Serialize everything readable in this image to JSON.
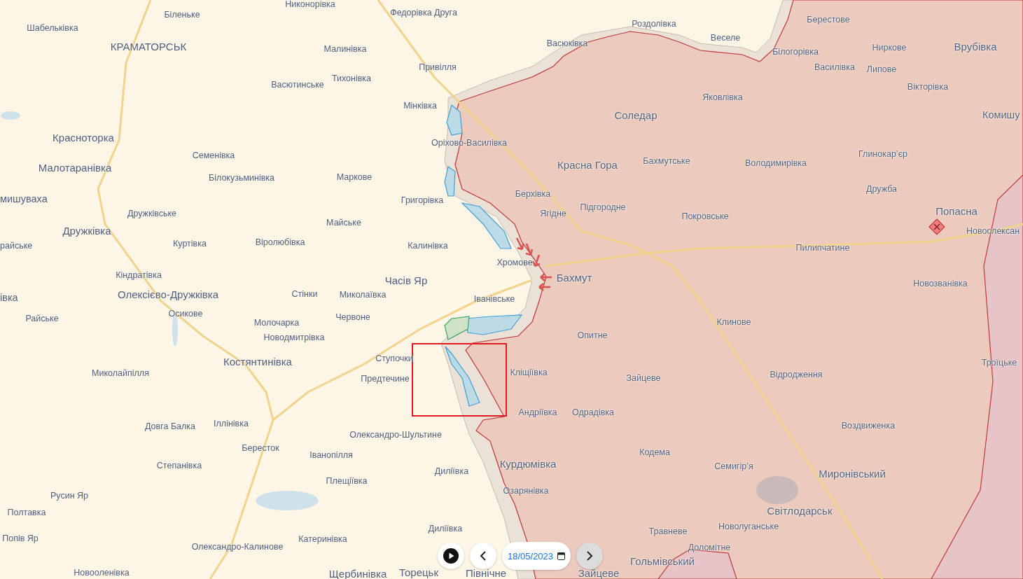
{
  "map": {
    "labels": [
      {
        "text": "Никонорівка",
        "kind": "town"
      },
      {
        "text": "Шабельківка",
        "kind": "town"
      },
      {
        "text": "Біленьке",
        "kind": "town"
      },
      {
        "text": "Федорівка Друга",
        "kind": "town"
      },
      {
        "text": "Роздолівка",
        "kind": "town"
      },
      {
        "text": "Берестове",
        "kind": "town"
      },
      {
        "text": "КРАМАТОРСЬК",
        "kind": "city"
      },
      {
        "text": "Малинівка",
        "kind": "town"
      },
      {
        "text": "Васюківка",
        "kind": "town"
      },
      {
        "text": "Веселе",
        "kind": "town"
      },
      {
        "text": "Білогорівка",
        "kind": "town"
      },
      {
        "text": "Ниркове",
        "kind": "town"
      },
      {
        "text": "Врубівка",
        "kind": "city"
      },
      {
        "text": "Васютинське",
        "kind": "town"
      },
      {
        "text": "Тихонівка",
        "kind": "town"
      },
      {
        "text": "Привілля",
        "kind": "town"
      },
      {
        "text": "Василівка",
        "kind": "town"
      },
      {
        "text": "Липове",
        "kind": "town"
      },
      {
        "text": "Вікторівка",
        "kind": "town"
      },
      {
        "text": "Мінківка",
        "kind": "town"
      },
      {
        "text": "Яковлівка",
        "kind": "town"
      },
      {
        "text": "Соледар",
        "kind": "city"
      },
      {
        "text": "Комишу",
        "kind": "city"
      },
      {
        "text": "Красноторка",
        "kind": "city"
      },
      {
        "text": "Оріхово-Василівка",
        "kind": "town"
      },
      {
        "text": "Малотаранівка",
        "kind": "city"
      },
      {
        "text": "Семенівка",
        "kind": "town"
      },
      {
        "text": "Красна Гора",
        "kind": "city"
      },
      {
        "text": "Бахмутське",
        "kind": "town"
      },
      {
        "text": "Володимирівка",
        "kind": "town"
      },
      {
        "text": "Глинокар’єр",
        "kind": "town"
      },
      {
        "text": "Білокузьминівка",
        "kind": "town"
      },
      {
        "text": "Маркове",
        "kind": "town"
      },
      {
        "text": "мишуваха",
        "kind": "city"
      },
      {
        "text": "Григорівка",
        "kind": "town"
      },
      {
        "text": "Берхівка",
        "kind": "town"
      },
      {
        "text": "Дружба",
        "kind": "town"
      },
      {
        "text": "Дружківка",
        "kind": "city"
      },
      {
        "text": "Дружківське",
        "kind": "town"
      },
      {
        "text": "Майське",
        "kind": "town"
      },
      {
        "text": "Ягідне",
        "kind": "town"
      },
      {
        "text": "Підгородне",
        "kind": "town"
      },
      {
        "text": "Покровське",
        "kind": "town"
      },
      {
        "text": "Попасна",
        "kind": "city"
      },
      {
        "text": "Новоолексан",
        "kind": "town"
      },
      {
        "text": "райське",
        "kind": "town"
      },
      {
        "text": "Куртівка",
        "kind": "town"
      },
      {
        "text": "Віролюбівка",
        "kind": "town"
      },
      {
        "text": "Калинівка",
        "kind": "town"
      },
      {
        "text": "Пилипчатине",
        "kind": "town"
      },
      {
        "text": "Хромове",
        "kind": "town"
      },
      {
        "text": "Кіндратівка",
        "kind": "town"
      },
      {
        "text": "Часів Яр",
        "kind": "city"
      },
      {
        "text": "Бахмут",
        "kind": "city"
      },
      {
        "text": "Новозванівка",
        "kind": "town"
      },
      {
        "text": "івка",
        "kind": "city"
      },
      {
        "text": "Олексієво-Дружківка",
        "kind": "city"
      },
      {
        "text": "Стінки",
        "kind": "town"
      },
      {
        "text": "Миколаївка",
        "kind": "town"
      },
      {
        "text": "Іванівське",
        "kind": "town"
      },
      {
        "text": "Райське",
        "kind": "town"
      },
      {
        "text": "Осикове",
        "kind": "town"
      },
      {
        "text": "Молочарка",
        "kind": "town"
      },
      {
        "text": "Червоне",
        "kind": "town"
      },
      {
        "text": "Клинове",
        "kind": "town"
      },
      {
        "text": "Новодмитрівка",
        "kind": "town"
      },
      {
        "text": "Опитне",
        "kind": "town"
      },
      {
        "text": "Костянтинівка",
        "kind": "city"
      },
      {
        "text": "Ступочки",
        "kind": "town"
      },
      {
        "text": "Троїцьке",
        "kind": "town"
      },
      {
        "text": "Миколайпілля",
        "kind": "town"
      },
      {
        "text": "Предтечине",
        "kind": "town"
      },
      {
        "text": "Кліщіївка",
        "kind": "town"
      },
      {
        "text": "Зайцеве",
        "kind": "town"
      },
      {
        "text": "Відродження",
        "kind": "town"
      },
      {
        "text": "Андріївка",
        "kind": "town"
      },
      {
        "text": "Одрадівка",
        "kind": "town"
      },
      {
        "text": "Довга Балка",
        "kind": "town"
      },
      {
        "text": "Іллінівка",
        "kind": "town"
      },
      {
        "text": "Олександро-Шультине",
        "kind": "town"
      },
      {
        "text": "Воздвиженка",
        "kind": "town"
      },
      {
        "text": "Бересток",
        "kind": "town"
      },
      {
        "text": "Іванопілля",
        "kind": "town"
      },
      {
        "text": "Кодема",
        "kind": "town"
      },
      {
        "text": "Степанівка",
        "kind": "town"
      },
      {
        "text": "Плещіївка",
        "kind": "town"
      },
      {
        "text": "Диліївка",
        "kind": "town"
      },
      {
        "text": "Курдюмівка",
        "kind": "city"
      },
      {
        "text": "Семигір’я",
        "kind": "town"
      },
      {
        "text": "Миронівський",
        "kind": "city"
      },
      {
        "text": "Русин Яр",
        "kind": "town"
      },
      {
        "text": "Озарянівка",
        "kind": "town"
      },
      {
        "text": "Полтавка",
        "kind": "town"
      },
      {
        "text": "Світлодарськ",
        "kind": "city"
      },
      {
        "text": "Попів Яр",
        "kind": "town"
      },
      {
        "text": "Олександро-Калинове",
        "kind": "town"
      },
      {
        "text": "Катеринівка",
        "kind": "town"
      },
      {
        "text": "Диліївка",
        "kind": "town"
      },
      {
        "text": "Травневе",
        "kind": "town"
      },
      {
        "text": "Новолуганське",
        "kind": "town"
      },
      {
        "text": "Доломітне",
        "kind": "town"
      },
      {
        "text": "Гольмівський",
        "kind": "city"
      },
      {
        "text": "Новооленівка",
        "kind": "town"
      },
      {
        "text": "Щербинівка",
        "kind": "city"
      },
      {
        "text": "Торецьк",
        "kind": "city"
      },
      {
        "text": "Північне",
        "kind": "city"
      },
      {
        "text": "Зайцеве",
        "kind": "city"
      }
    ]
  },
  "timeline": {
    "date": "18/05/2023",
    "prev_button": {
      "disabled": false
    },
    "next_button": {
      "disabled": true
    }
  }
}
